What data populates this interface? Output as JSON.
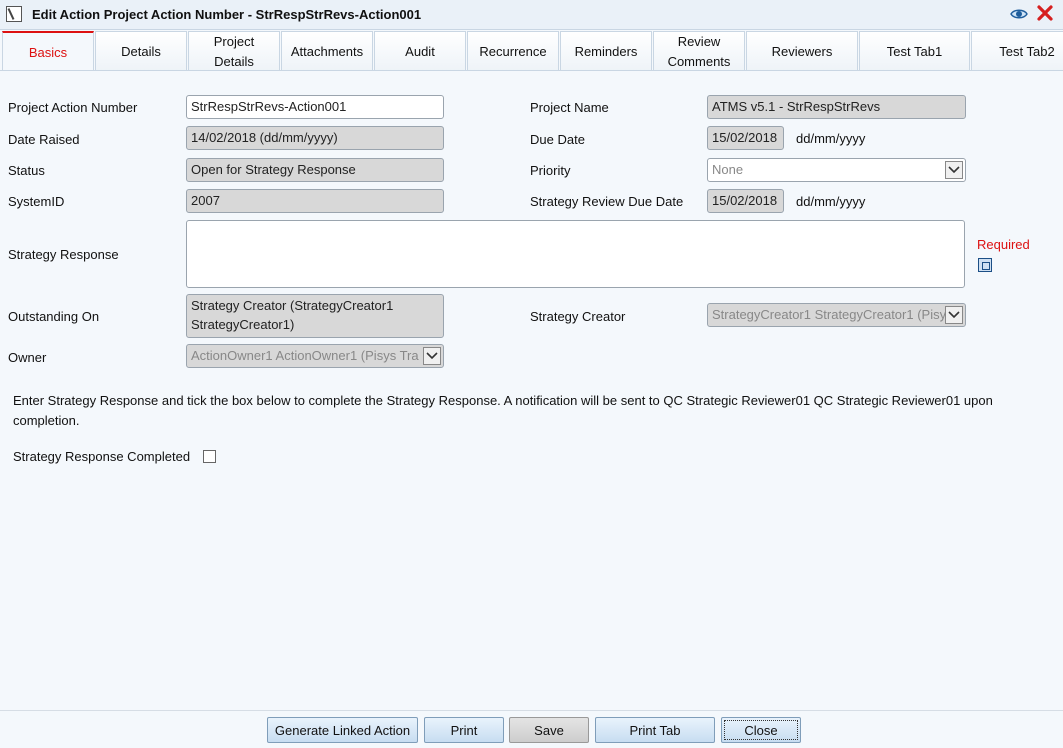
{
  "window": {
    "title": "Edit Action Project Action Number - StrRespStrRevs-Action001"
  },
  "tabs": [
    {
      "label": "Basics"
    },
    {
      "label": "Details"
    },
    {
      "label": "Project Details"
    },
    {
      "label": "Attachments"
    },
    {
      "label": "Audit"
    },
    {
      "label": "Recurrence"
    },
    {
      "label": "Reminders"
    },
    {
      "label": "Review Comments"
    },
    {
      "label": "Reviewers"
    },
    {
      "label": "Test Tab1"
    },
    {
      "label": "Test Tab2"
    }
  ],
  "form": {
    "project_action_number": {
      "label": "Project Action Number",
      "value": "StrRespStrRevs-Action001"
    },
    "project_name": {
      "label": "Project Name",
      "value": "ATMS v5.1 - StrRespStrRevs"
    },
    "date_raised": {
      "label": "Date Raised",
      "value": "14/02/2018 (dd/mm/yyyy)"
    },
    "due_date": {
      "label": "Due Date",
      "value": "15/02/2018",
      "format": "dd/mm/yyyy"
    },
    "status": {
      "label": "Status",
      "value": "Open for Strategy Response"
    },
    "priority": {
      "label": "Priority",
      "value": "None"
    },
    "system_id": {
      "label": "SystemID",
      "value": "2007"
    },
    "strategy_review_due_date": {
      "label": "Strategy Review Due Date",
      "value": "15/02/2018",
      "format": "dd/mm/yyyy"
    },
    "strategy_response": {
      "label": "Strategy Response",
      "value": "",
      "required_label": "Required"
    },
    "outstanding_on": {
      "label": "Outstanding On",
      "value": "Strategy Creator (StrategyCreator1 StrategyCreator1)"
    },
    "strategy_creator": {
      "label": "Strategy Creator",
      "value": "StrategyCreator1 StrategyCreator1 (Pisys"
    },
    "owner": {
      "label": "Owner",
      "value": "ActionOwner1 ActionOwner1 (Pisys Tra"
    }
  },
  "info_text": "Enter Strategy Response and tick the box below to complete the Strategy Response. A notification will be sent to QC Strategic Reviewer01 QC Strategic Reviewer01 upon completion.",
  "completed_checkbox": {
    "label": "Strategy Response Completed",
    "checked": false
  },
  "buttons": {
    "generate_linked": "Generate Linked Action",
    "print": "Print",
    "save": "Save",
    "print_tab": "Print Tab",
    "close": "Close"
  }
}
